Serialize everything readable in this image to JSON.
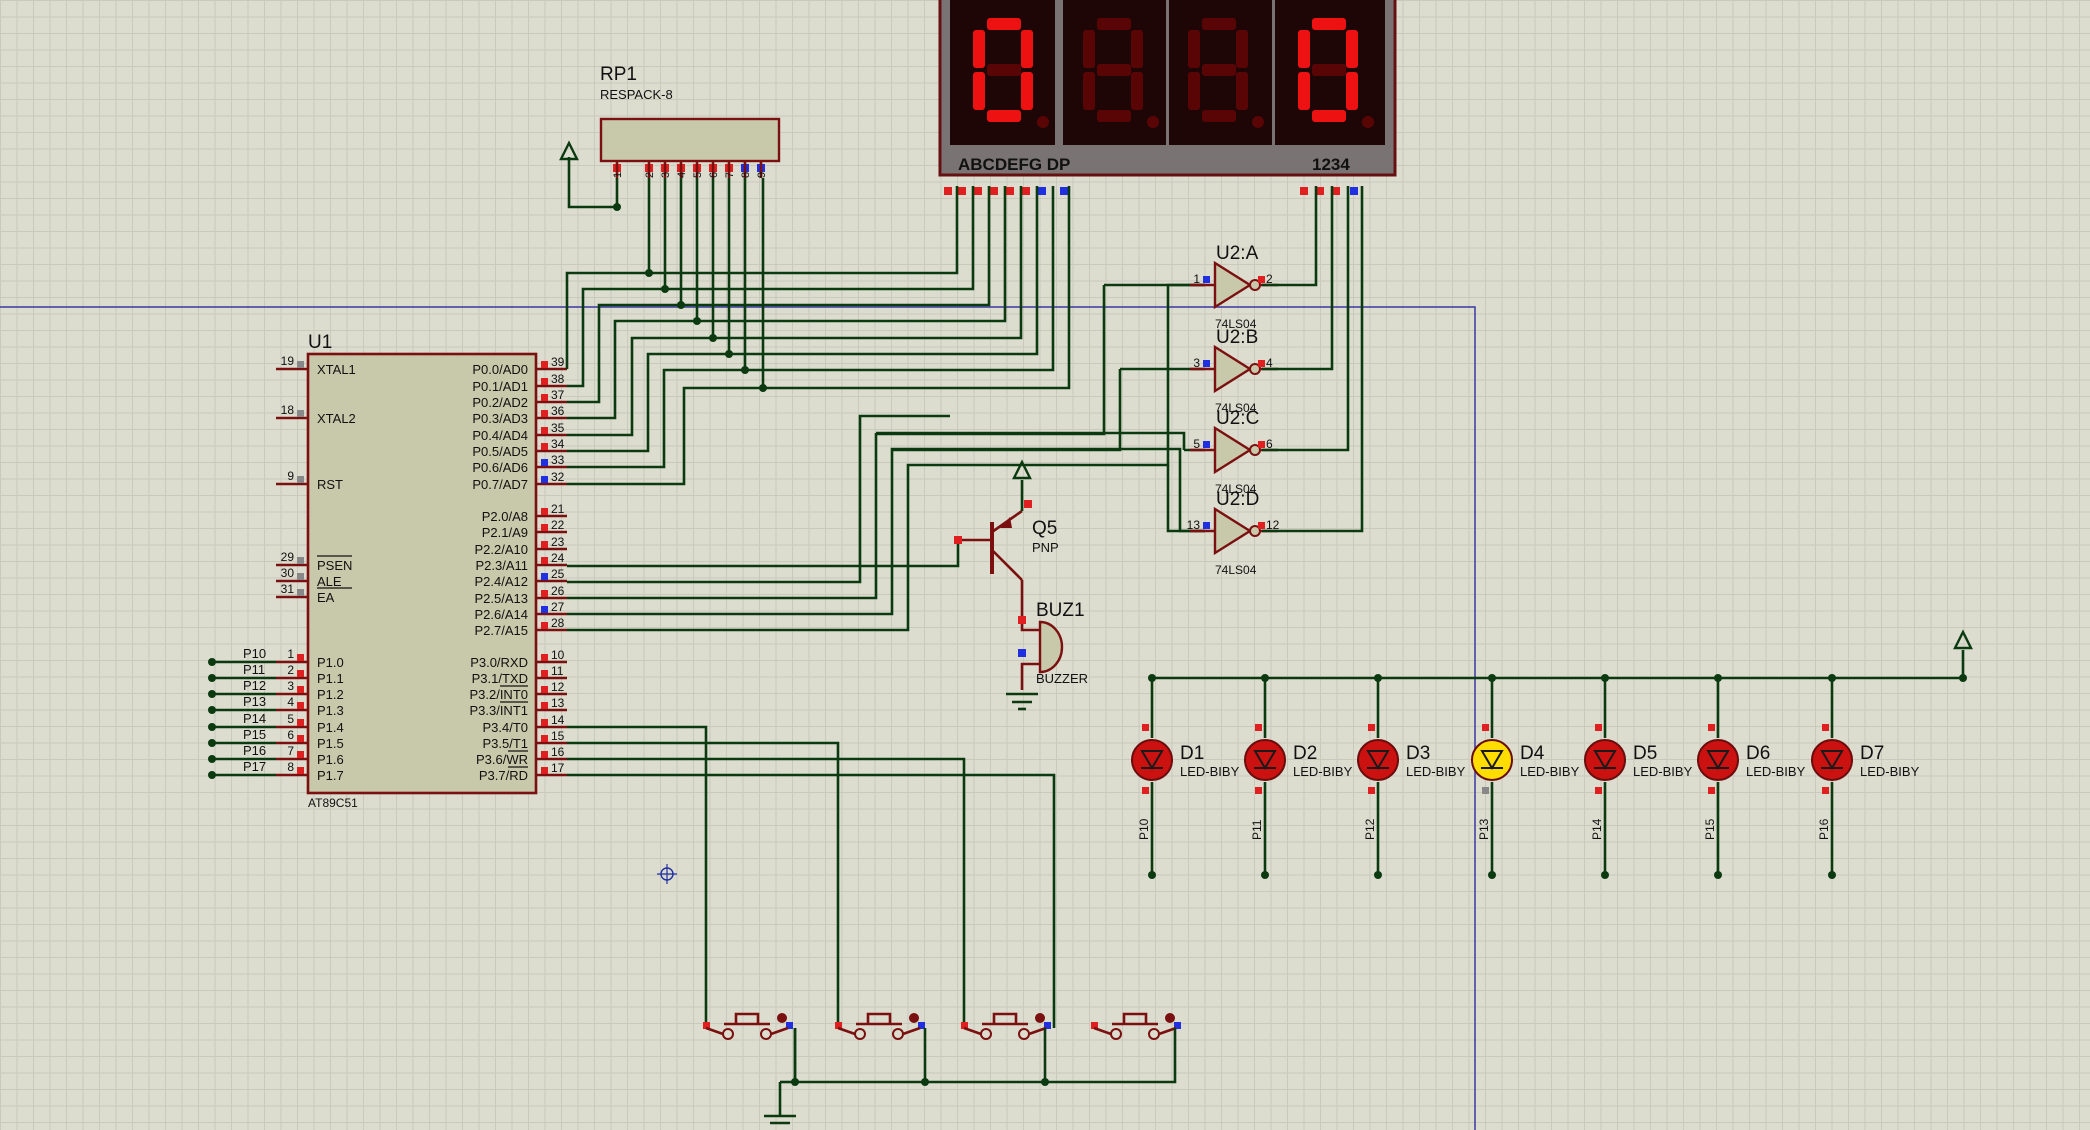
{
  "display": {
    "digits": [
      "0",
      "",
      "",
      "0"
    ],
    "segment_label": "ABCDEFG DP",
    "digit_label": "1234",
    "color_on": "#ee1111",
    "color_off": "#5a0505",
    "body_color": "#7a7373"
  },
  "rp1": {
    "name": "RP1",
    "type": "RESPACK-8",
    "pins": [
      "1",
      "2",
      "3",
      "4",
      "5",
      "6",
      "7",
      "8",
      "9"
    ]
  },
  "u1": {
    "name": "U1",
    "type": "AT89C51",
    "left_pins": [
      {
        "num": "19",
        "label": "XTAL1"
      },
      {
        "num": "18",
        "label": "XTAL2"
      },
      {
        "num": "9",
        "label": "RST"
      },
      {
        "num": "29",
        "label": "PSEN"
      },
      {
        "num": "30",
        "label": "ALE"
      },
      {
        "num": "31",
        "label": "EA"
      },
      {
        "num": "1",
        "label": "P1.0",
        "net": "P10"
      },
      {
        "num": "2",
        "label": "P1.1",
        "net": "P11"
      },
      {
        "num": "3",
        "label": "P1.2",
        "net": "P12"
      },
      {
        "num": "4",
        "label": "P1.3",
        "net": "P13"
      },
      {
        "num": "5",
        "label": "P1.4",
        "net": "P14"
      },
      {
        "num": "6",
        "label": "P1.5",
        "net": "P15"
      },
      {
        "num": "7",
        "label": "P1.6",
        "net": "P16"
      },
      {
        "num": "8",
        "label": "P1.7",
        "net": "P17"
      }
    ],
    "right_pins": [
      {
        "num": "39",
        "label": "P0.0/AD0"
      },
      {
        "num": "38",
        "label": "P0.1/AD1"
      },
      {
        "num": "37",
        "label": "P0.2/AD2"
      },
      {
        "num": "36",
        "label": "P0.3/AD3"
      },
      {
        "num": "35",
        "label": "P0.4/AD4"
      },
      {
        "num": "34",
        "label": "P0.5/AD5"
      },
      {
        "num": "33",
        "label": "P0.6/AD6"
      },
      {
        "num": "32",
        "label": "P0.7/AD7"
      },
      {
        "num": "21",
        "label": "P2.0/A8"
      },
      {
        "num": "22",
        "label": "P2.1/A9"
      },
      {
        "num": "23",
        "label": "P2.2/A10"
      },
      {
        "num": "24",
        "label": "P2.3/A11"
      },
      {
        "num": "25",
        "label": "P2.4/A12"
      },
      {
        "num": "26",
        "label": "P2.5/A13"
      },
      {
        "num": "27",
        "label": "P2.6/A14"
      },
      {
        "num": "28",
        "label": "P2.7/A15"
      },
      {
        "num": "10",
        "label": "P3.0/RXD"
      },
      {
        "num": "11",
        "label": "P3.1/TXD"
      },
      {
        "num": "12",
        "label": "P3.2/INT0"
      },
      {
        "num": "13",
        "label": "P3.3/INT1"
      },
      {
        "num": "14",
        "label": "P3.4/T0"
      },
      {
        "num": "15",
        "label": "P3.5/T1"
      },
      {
        "num": "16",
        "label": "P3.6/WR"
      },
      {
        "num": "17",
        "label": "P3.7/RD"
      }
    ]
  },
  "inverters": [
    {
      "name": "U2:A",
      "type": "74LS04",
      "in": "1",
      "out": "2"
    },
    {
      "name": "U2:B",
      "type": "74LS04",
      "in": "3",
      "out": "4"
    },
    {
      "name": "U2:C",
      "type": "74LS04",
      "in": "5",
      "out": "6"
    },
    {
      "name": "U2:D",
      "type": "74LS04",
      "in": "13",
      "out": "12"
    }
  ],
  "transistor": {
    "name": "Q5",
    "type": "PNP"
  },
  "buzzer": {
    "name": "BUZ1",
    "type": "BUZZER"
  },
  "leds": [
    {
      "name": "D1",
      "type": "LED-BIBY",
      "net": "P10",
      "lit": false
    },
    {
      "name": "D2",
      "type": "LED-BIBY",
      "net": "P11",
      "lit": false
    },
    {
      "name": "D3",
      "type": "LED-BIBY",
      "net": "P12",
      "lit": false
    },
    {
      "name": "D4",
      "type": "LED-BIBY",
      "net": "P13",
      "lit": true
    },
    {
      "name": "D5",
      "type": "LED-BIBY",
      "net": "P14",
      "lit": false
    },
    {
      "name": "D6",
      "type": "LED-BIBY",
      "net": "P15",
      "lit": false
    },
    {
      "name": "D7",
      "type": "LED-BIBY",
      "net": "P16",
      "lit": false
    }
  ],
  "buttons": [
    "btn1",
    "btn2",
    "btn3",
    "btn4"
  ],
  "colors": {
    "wire": "#0c3a10",
    "part": "#7a1010",
    "part_fill": "#c8c8aa",
    "led_off": "#cc1111",
    "led_on": "#ffdd00",
    "pin_red": "#e02020",
    "pin_blue": "#2030e0"
  }
}
